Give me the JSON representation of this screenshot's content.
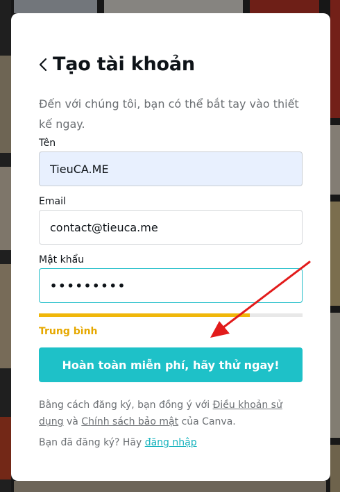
{
  "modal": {
    "title": "Tạo tài khoản",
    "subtitle": "Đến với chúng tôi, bạn có thể bắt tay vào thiết kế ngay.",
    "name_label": "Tên",
    "name_value": "TieuCA.ME",
    "email_label": "Email",
    "email_value": "contact@tieuca.me",
    "password_label": "Mật khẩu",
    "password_mask": "•••••••••",
    "password_strength_fraction": 0.8,
    "password_strength_label": "Trung bình",
    "submit_label": "Hoàn toàn miễn phí, hãy thử ngay!",
    "terms_prefix": "Bằng cách đăng ký, bạn đồng ý với ",
    "terms_link": "Điều khoản sử dụng",
    "terms_mid": " và ",
    "privacy_link": "Chính sách bảo mật",
    "terms_suffix": " của Canva.",
    "login_prefix": "Bạn đã đăng ký? Hãy ",
    "login_link": "đăng nhập"
  },
  "colors": {
    "accent": "#1ec1c8",
    "strength": "#e6a800",
    "arrow": "#e21b1b"
  }
}
